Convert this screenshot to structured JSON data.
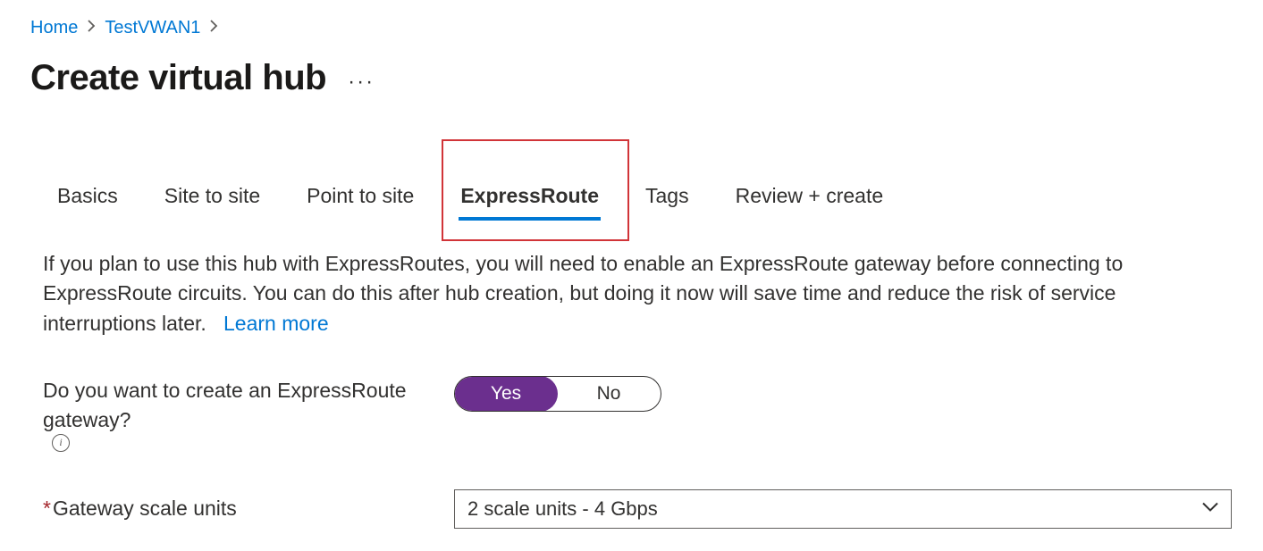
{
  "breadcrumb": {
    "items": [
      "Home",
      "TestVWAN1"
    ]
  },
  "page_title": "Create virtual hub",
  "tabs": {
    "items": [
      {
        "label": "Basics"
      },
      {
        "label": "Site to site"
      },
      {
        "label": "Point to site"
      },
      {
        "label": "ExpressRoute"
      },
      {
        "label": "Tags"
      },
      {
        "label": "Review + create"
      }
    ],
    "active_index": 3
  },
  "description": {
    "text": "If you plan to use this hub with ExpressRoutes, you will need to enable an ExpressRoute gateway before connecting to ExpressRoute circuits. You can do this after hub creation, but doing it now will save time and reduce the risk of service interruptions later.",
    "learn_more": "Learn more"
  },
  "form": {
    "create_gateway": {
      "label": "Do you want to create an ExpressRoute gateway?",
      "yes": "Yes",
      "no": "No",
      "selected": "Yes"
    },
    "scale_units": {
      "label": "Gateway scale units",
      "value": "2 scale units - 4 Gbps"
    }
  }
}
